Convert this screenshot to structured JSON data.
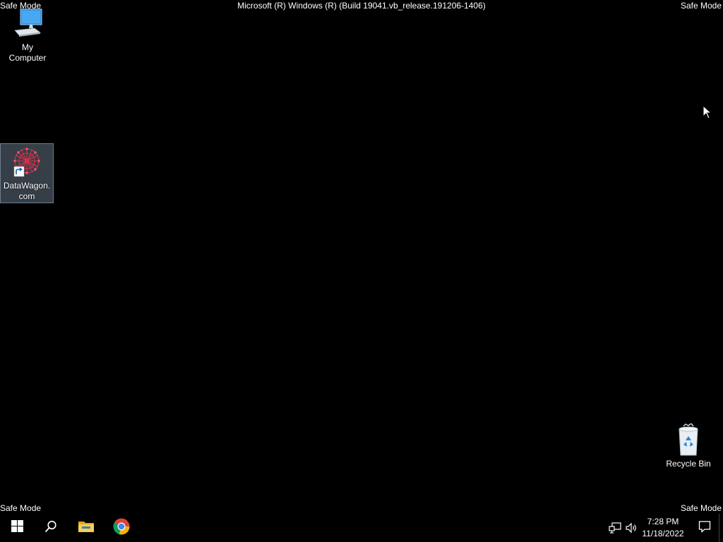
{
  "overlay": {
    "safe_mode_top_left": "Safe Mode",
    "safe_mode_top_right": "Safe Mode",
    "safe_mode_bottom_left": "Safe Mode",
    "safe_mode_bottom_right": "Safe Mode",
    "build_text": "Microsoft (R) Windows (R) (Build 19041.vb_release.191206-1406)"
  },
  "desktop_icons": [
    {
      "label": "My Computer",
      "icon": "computer-icon"
    },
    {
      "label": "DataWagon.com",
      "icon": "datawagon-shortcut-icon",
      "selected": true
    },
    {
      "label": "Recycle Bin",
      "icon": "recycle-bin-icon"
    }
  ],
  "taskbar": {
    "buttons": [
      {
        "name": "start",
        "icon": "windows-logo-icon"
      },
      {
        "name": "search",
        "icon": "search-icon"
      },
      {
        "name": "file-explorer",
        "icon": "folder-icon"
      },
      {
        "name": "chrome",
        "icon": "chrome-icon"
      }
    ],
    "tray": {
      "network_icon": "network-icon",
      "volume_icon": "volume-icon",
      "time": "7:28 PM",
      "date": "11/18/2022",
      "notification_icon": "notification-icon"
    }
  },
  "colors": {
    "desktop_background": "#000000",
    "selection_highlight": "#788ca0",
    "folder_yellow": "#f2c23d",
    "taskbar": "#000000"
  }
}
